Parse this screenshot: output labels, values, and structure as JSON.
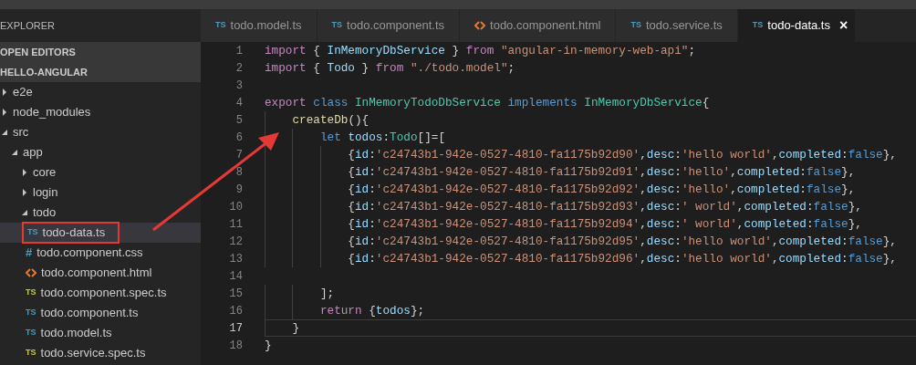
{
  "explorer": {
    "title": "EXPLORER",
    "sections": [
      {
        "label": "OPEN EDITORS"
      },
      {
        "label": "HELLO-ANGULAR"
      }
    ],
    "tree": [
      {
        "name": "e2e",
        "kind": "folder",
        "expanded": false
      },
      {
        "name": "node_modules",
        "kind": "folder",
        "expanded": false
      },
      {
        "name": "src",
        "kind": "folder",
        "expanded": true,
        "children": [
          {
            "name": "app",
            "kind": "folder",
            "expanded": true,
            "children": [
              {
                "name": "core",
                "kind": "folder",
                "expanded": false
              },
              {
                "name": "login",
                "kind": "folder",
                "expanded": false
              },
              {
                "name": "todo",
                "kind": "folder",
                "expanded": true,
                "children": [
                  {
                    "name": "todo-data.ts",
                    "kind": "ts",
                    "badge": "TS",
                    "selected": true,
                    "annotated": true
                  },
                  {
                    "name": "todo.component.css",
                    "kind": "css",
                    "badge": "#",
                    "selected": false,
                    "annotated": false
                  },
                  {
                    "name": "todo.component.html",
                    "kind": "html",
                    "selected": false,
                    "annotated": false
                  },
                  {
                    "name": "todo.component.spec.ts",
                    "kind": "spec",
                    "badge": "TS",
                    "selected": false,
                    "annotated": false
                  },
                  {
                    "name": "todo.component.ts",
                    "kind": "ts",
                    "badge": "TS",
                    "selected": false,
                    "annotated": false
                  },
                  {
                    "name": "todo.model.ts",
                    "kind": "ts",
                    "badge": "TS",
                    "selected": false,
                    "annotated": false
                  },
                  {
                    "name": "todo.service.spec.ts",
                    "kind": "spec",
                    "badge": "TS",
                    "selected": false,
                    "annotated": false
                  }
                ]
              }
            ]
          }
        ]
      }
    ]
  },
  "tabs": [
    {
      "label": "todo.model.ts",
      "kind": "ts",
      "badge": "TS",
      "selected": false
    },
    {
      "label": "todo.component.ts",
      "kind": "ts",
      "badge": "TS",
      "selected": false
    },
    {
      "label": "todo.component.html",
      "kind": "html",
      "selected": false
    },
    {
      "label": "todo.service.ts",
      "kind": "ts",
      "badge": "TS",
      "selected": false
    },
    {
      "label": "todo-data.ts",
      "kind": "ts",
      "badge": "TS",
      "selected": true,
      "close": "×"
    }
  ],
  "code": {
    "lines": [
      {
        "number": "1",
        "current": false,
        "tokens": [
          {
            "text": "import",
            "kind": "keyword"
          },
          {
            "text": " { ",
            "kind": "punct"
          },
          {
            "text": "InMemoryDbService",
            "kind": "var"
          },
          {
            "text": " } ",
            "kind": "punct"
          },
          {
            "text": "from",
            "kind": "keyword"
          },
          {
            "text": " \"angular-in-memory-web-api\"",
            "kind": "string"
          },
          {
            "text": ";",
            "kind": "punct"
          }
        ]
      },
      {
        "number": "2",
        "current": false,
        "tokens": [
          {
            "text": "import",
            "kind": "keyword"
          },
          {
            "text": " { ",
            "kind": "punct"
          },
          {
            "text": "Todo",
            "kind": "var"
          },
          {
            "text": " } ",
            "kind": "punct"
          },
          {
            "text": "from",
            "kind": "keyword"
          },
          {
            "text": " \"./todo.model\"",
            "kind": "string"
          },
          {
            "text": ";",
            "kind": "punct"
          }
        ]
      },
      {
        "number": "3",
        "current": false
      },
      {
        "number": "4",
        "current": false,
        "tokens": [
          {
            "text": "export",
            "kind": "keyword"
          },
          {
            "text": " class",
            "kind": "storage"
          },
          {
            "text": " InMemoryTodoDbService",
            "kind": "type"
          },
          {
            "text": " implements",
            "kind": "storage"
          },
          {
            "text": " InMemoryDbService",
            "kind": "type"
          },
          {
            "text": "{",
            "kind": "punct"
          }
        ]
      },
      {
        "number": "5",
        "current": false,
        "tokens": [
          {
            "text": "    createDb",
            "kind": "function"
          },
          {
            "text": "(){",
            "kind": "punct"
          }
        ]
      },
      {
        "number": "6",
        "current": false,
        "tokens": [
          {
            "text": "        let",
            "kind": "storage"
          },
          {
            "text": " todos",
            "kind": "var"
          },
          {
            "text": ":",
            "kind": "punct"
          },
          {
            "text": "Todo",
            "kind": "type"
          },
          {
            "text": "[]=[",
            "kind": "punct"
          }
        ]
      },
      {
        "number": "7",
        "current": false,
        "tokens": [
          {
            "text": "            {",
            "kind": "punct"
          },
          {
            "text": "id",
            "kind": "var"
          },
          {
            "text": ":",
            "kind": "punct"
          },
          {
            "text": "'c24743b1-942e-0527-4810-fa1175b92d90'",
            "kind": "string"
          },
          {
            "text": ",",
            "kind": "punct"
          },
          {
            "text": "desc",
            "kind": "var"
          },
          {
            "text": ":",
            "kind": "punct"
          },
          {
            "text": "'hello world'",
            "kind": "string"
          },
          {
            "text": ",",
            "kind": "punct"
          },
          {
            "text": "completed",
            "kind": "var"
          },
          {
            "text": ":",
            "kind": "punct"
          },
          {
            "text": "false",
            "kind": "storage"
          },
          {
            "text": "},",
            "kind": "punct"
          }
        ]
      },
      {
        "number": "8",
        "current": false,
        "tokens": [
          {
            "text": "            {",
            "kind": "punct"
          },
          {
            "text": "id",
            "kind": "var"
          },
          {
            "text": ":",
            "kind": "punct"
          },
          {
            "text": "'c24743b1-942e-0527-4810-fa1175b92d91'",
            "kind": "string"
          },
          {
            "text": ",",
            "kind": "punct"
          },
          {
            "text": "desc",
            "kind": "var"
          },
          {
            "text": ":",
            "kind": "punct"
          },
          {
            "text": "'hello'",
            "kind": "string"
          },
          {
            "text": ",",
            "kind": "punct"
          },
          {
            "text": "completed",
            "kind": "var"
          },
          {
            "text": ":",
            "kind": "punct"
          },
          {
            "text": "false",
            "kind": "storage"
          },
          {
            "text": "},",
            "kind": "punct"
          }
        ]
      },
      {
        "number": "9",
        "current": false,
        "tokens": [
          {
            "text": "            {",
            "kind": "punct"
          },
          {
            "text": "id",
            "kind": "var"
          },
          {
            "text": ":",
            "kind": "punct"
          },
          {
            "text": "'c24743b1-942e-0527-4810-fa1175b92d92'",
            "kind": "string"
          },
          {
            "text": ",",
            "kind": "punct"
          },
          {
            "text": "desc",
            "kind": "var"
          },
          {
            "text": ":",
            "kind": "punct"
          },
          {
            "text": "'hello'",
            "kind": "string"
          },
          {
            "text": ",",
            "kind": "punct"
          },
          {
            "text": "completed",
            "kind": "var"
          },
          {
            "text": ":",
            "kind": "punct"
          },
          {
            "text": "false",
            "kind": "storage"
          },
          {
            "text": "},",
            "kind": "punct"
          }
        ]
      },
      {
        "number": "10",
        "current": false,
        "tokens": [
          {
            "text": "            {",
            "kind": "punct"
          },
          {
            "text": "id",
            "kind": "var"
          },
          {
            "text": ":",
            "kind": "punct"
          },
          {
            "text": "'c24743b1-942e-0527-4810-fa1175b92d93'",
            "kind": "string"
          },
          {
            "text": ",",
            "kind": "punct"
          },
          {
            "text": "desc",
            "kind": "var"
          },
          {
            "text": ":",
            "kind": "punct"
          },
          {
            "text": "' world'",
            "kind": "string"
          },
          {
            "text": ",",
            "kind": "punct"
          },
          {
            "text": "completed",
            "kind": "var"
          },
          {
            "text": ":",
            "kind": "punct"
          },
          {
            "text": "false",
            "kind": "storage"
          },
          {
            "text": "},",
            "kind": "punct"
          }
        ]
      },
      {
        "number": "11",
        "current": false,
        "tokens": [
          {
            "text": "            {",
            "kind": "punct"
          },
          {
            "text": "id",
            "kind": "var"
          },
          {
            "text": ":",
            "kind": "punct"
          },
          {
            "text": "'c24743b1-942e-0527-4810-fa1175b92d94'",
            "kind": "string"
          },
          {
            "text": ",",
            "kind": "punct"
          },
          {
            "text": "desc",
            "kind": "var"
          },
          {
            "text": ":",
            "kind": "punct"
          },
          {
            "text": "' world'",
            "kind": "string"
          },
          {
            "text": ",",
            "kind": "punct"
          },
          {
            "text": "completed",
            "kind": "var"
          },
          {
            "text": ":",
            "kind": "punct"
          },
          {
            "text": "false",
            "kind": "storage"
          },
          {
            "text": "},",
            "kind": "punct"
          }
        ]
      },
      {
        "number": "12",
        "current": false,
        "tokens": [
          {
            "text": "            {",
            "kind": "punct"
          },
          {
            "text": "id",
            "kind": "var"
          },
          {
            "text": ":",
            "kind": "punct"
          },
          {
            "text": "'c24743b1-942e-0527-4810-fa1175b92d95'",
            "kind": "string"
          },
          {
            "text": ",",
            "kind": "punct"
          },
          {
            "text": "desc",
            "kind": "var"
          },
          {
            "text": ":",
            "kind": "punct"
          },
          {
            "text": "'hello world'",
            "kind": "string"
          },
          {
            "text": ",",
            "kind": "punct"
          },
          {
            "text": "completed",
            "kind": "var"
          },
          {
            "text": ":",
            "kind": "punct"
          },
          {
            "text": "false",
            "kind": "storage"
          },
          {
            "text": "},",
            "kind": "punct"
          }
        ]
      },
      {
        "number": "13",
        "current": false,
        "tokens": [
          {
            "text": "            {",
            "kind": "punct"
          },
          {
            "text": "id",
            "kind": "var"
          },
          {
            "text": ":",
            "kind": "punct"
          },
          {
            "text": "'c24743b1-942e-0527-4810-fa1175b92d96'",
            "kind": "string"
          },
          {
            "text": ",",
            "kind": "punct"
          },
          {
            "text": "desc",
            "kind": "var"
          },
          {
            "text": ":",
            "kind": "punct"
          },
          {
            "text": "'hello world'",
            "kind": "string"
          },
          {
            "text": ",",
            "kind": "punct"
          },
          {
            "text": "completed",
            "kind": "var"
          },
          {
            "text": ":",
            "kind": "punct"
          },
          {
            "text": "false",
            "kind": "storage"
          },
          {
            "text": "},",
            "kind": "punct"
          }
        ]
      },
      {
        "number": "14",
        "current": false
      },
      {
        "number": "15",
        "current": false,
        "tokens": [
          {
            "text": "        ];",
            "kind": "punct"
          }
        ]
      },
      {
        "number": "16",
        "current": false,
        "tokens": [
          {
            "text": "        return",
            "kind": "keyword"
          },
          {
            "text": " {",
            "kind": "punct"
          },
          {
            "text": "todos",
            "kind": "var"
          },
          {
            "text": "};",
            "kind": "punct"
          }
        ]
      },
      {
        "number": "17",
        "current": true,
        "tokens": [
          {
            "text": "    }",
            "kind": "punct"
          }
        ]
      },
      {
        "number": "18",
        "current": false,
        "tokens": [
          {
            "text": "}",
            "kind": "punct"
          }
        ]
      }
    ]
  }
}
